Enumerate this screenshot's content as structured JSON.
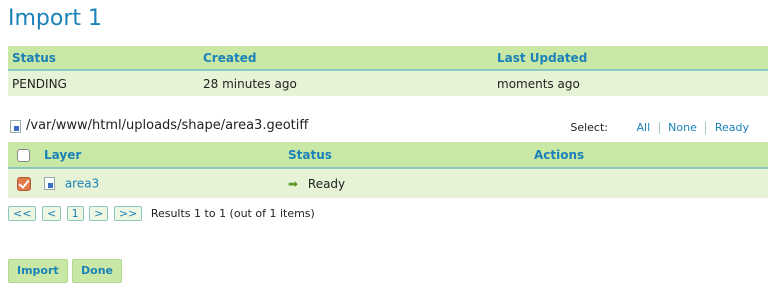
{
  "page": {
    "title": "Import 1"
  },
  "import_meta": {
    "headers": {
      "status": "Status",
      "created": "Created",
      "updated": "Last Updated"
    },
    "values": {
      "status": "PENDING",
      "created": "28 minutes ago",
      "updated": "moments ago"
    }
  },
  "file": {
    "path": "/var/www/html/uploads/shape/area3.geotiff"
  },
  "select": {
    "label": "Select:",
    "all": "All",
    "none": "None",
    "ready": "Ready"
  },
  "layers": {
    "headers": {
      "layer": "Layer",
      "status": "Status",
      "actions": "Actions"
    },
    "rows": [
      {
        "name": "area3",
        "status": "Ready",
        "checked": true
      }
    ]
  },
  "pagination": {
    "first": "<<",
    "prev": "<",
    "page": "1",
    "next": ">",
    "last": ">>",
    "summary": "Results 1 to 1 (out of 1 items)"
  },
  "buttons": {
    "import": "Import",
    "done": "Done"
  },
  "colors": {
    "accent": "#1a82b8",
    "header_bg": "#c9e7a5",
    "row_bg": "#e7f3d6",
    "ready_arrow": "#5c9a2a"
  }
}
